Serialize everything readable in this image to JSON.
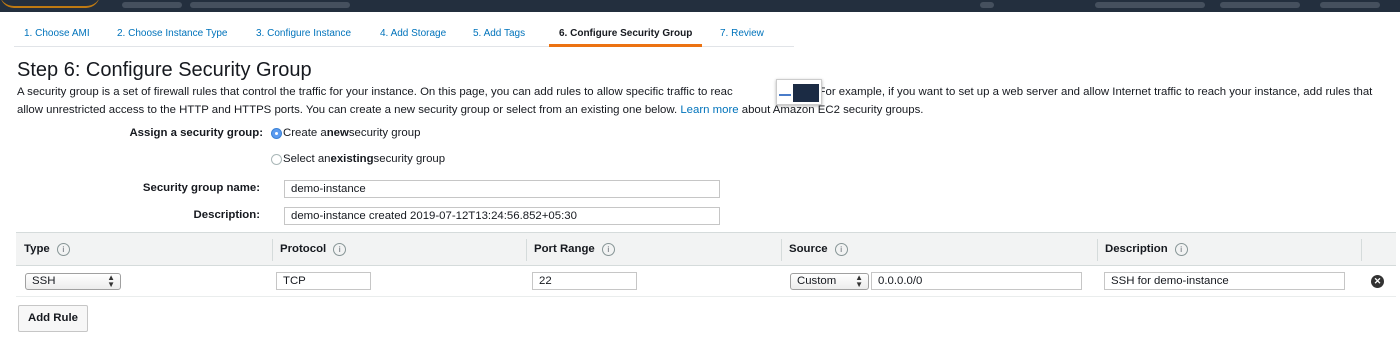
{
  "wizard": {
    "steps": [
      {
        "label": "1. Choose AMI"
      },
      {
        "label": "2. Choose Instance Type"
      },
      {
        "label": "3. Configure Instance"
      },
      {
        "label": "4. Add Storage"
      },
      {
        "label": "5. Add Tags"
      },
      {
        "label": "6. Configure Security Group"
      },
      {
        "label": "7. Review"
      }
    ],
    "active_index": 5
  },
  "page": {
    "title": "Step 6: Configure Security Group",
    "intro_part1": "A security group is a set of firewall rules that control the traffic for your instance. On this page, you can add rules to allow specific traffic to reac",
    "intro_part2": "stance. For example, if you want to set up a web server and allow Internet traffic to reach your instance, add rules that allow unrestricted access to the HTTP and HTTPS ports. You can create a new security group or select from an existing one below.",
    "learn_more": "Learn more",
    "intro_part3": "about Amazon EC2 security groups."
  },
  "assign": {
    "label": "Assign a security group:",
    "option_create_pre": "Create a ",
    "option_create_bold": "new",
    "option_create_post": " security group",
    "option_existing_pre": "Select an ",
    "option_existing_bold": "existing",
    "option_existing_post": " security group",
    "selected": "create"
  },
  "form": {
    "name_label": "Security group name:",
    "name_value": "demo-instance",
    "description_label": "Description:",
    "description_value": "demo-instance created 2019-07-12T13:24:56.852+05:30"
  },
  "table": {
    "headers": {
      "type": "Type",
      "protocol": "Protocol",
      "port_range": "Port Range",
      "source": "Source",
      "description": "Description"
    },
    "info_glyph": "i",
    "rows": [
      {
        "type": "SSH",
        "protocol": "TCP",
        "port_range": "22",
        "source_type": "Custom",
        "source_cidr": "0.0.0.0/0",
        "description": "SSH for demo-instance"
      }
    ]
  },
  "actions": {
    "add_rule": "Add Rule"
  },
  "icons": {
    "info": "info-icon",
    "remove": "close-circle-icon",
    "select_arrows": "updown-arrows-icon"
  },
  "colors": {
    "link": "#0073bb",
    "active_tab_underline": "#ec7211",
    "topbar": "#232f3e",
    "table_header_bg": "#f2f3f3"
  }
}
